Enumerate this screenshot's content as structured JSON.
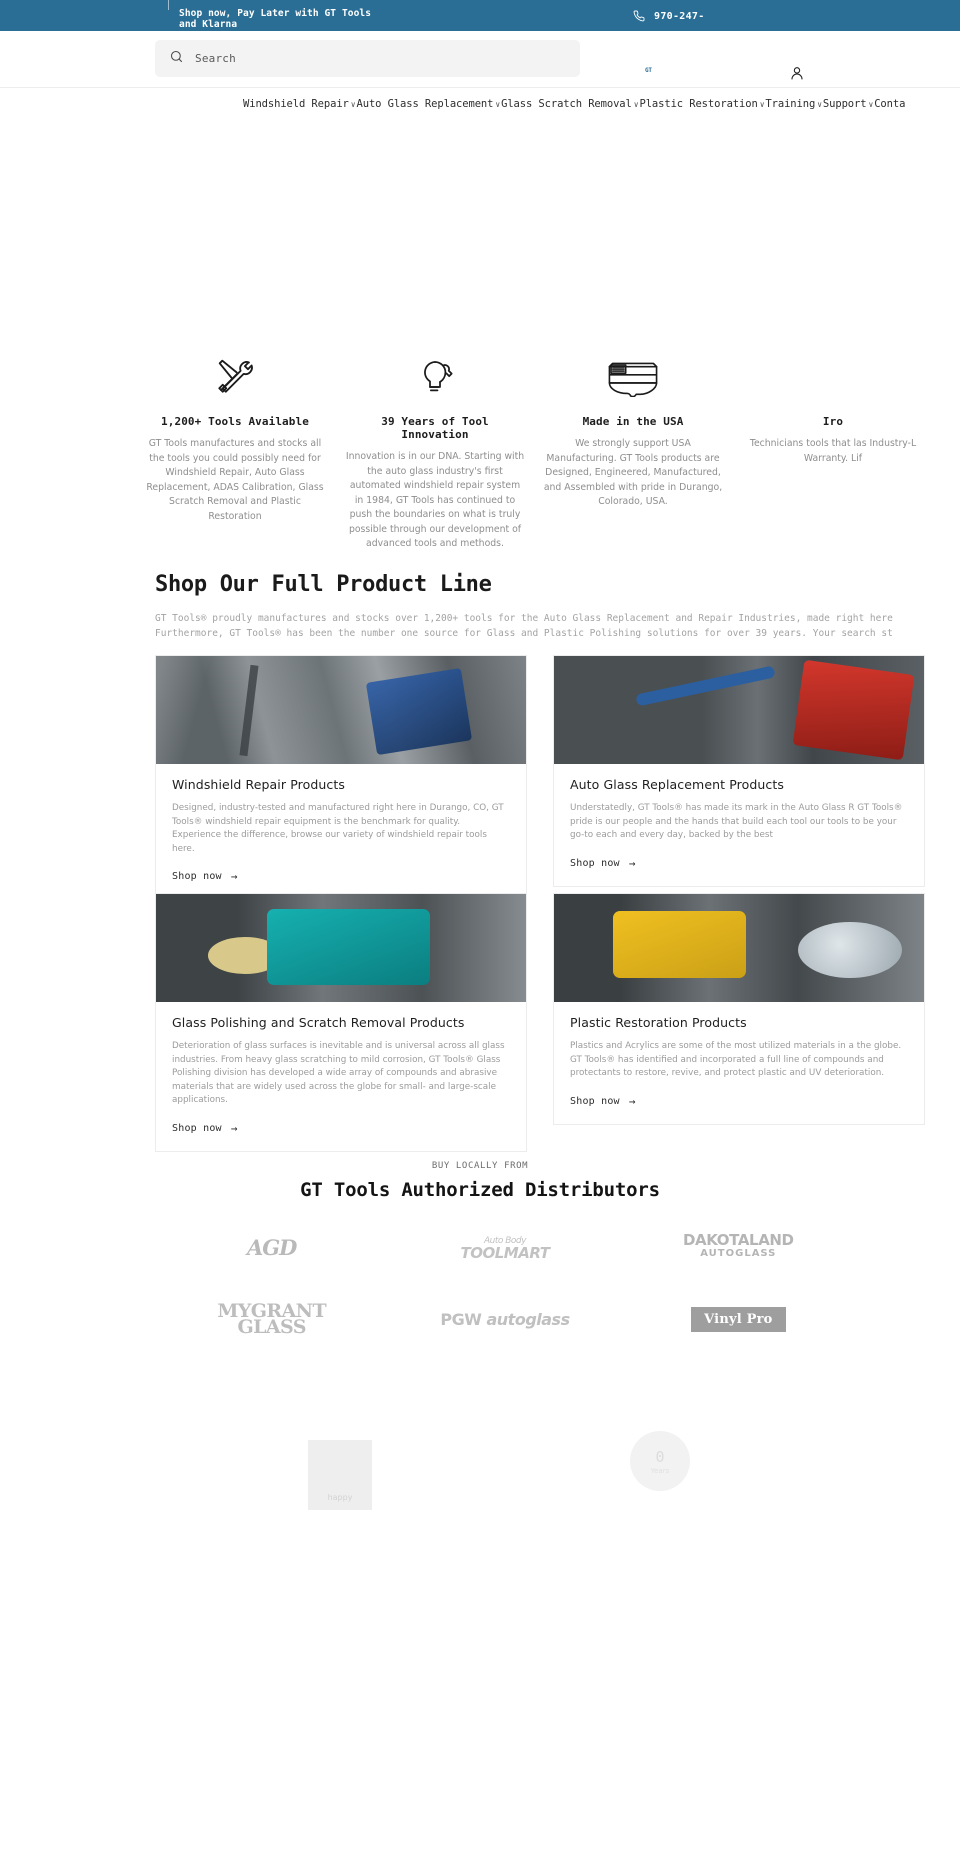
{
  "announcement": {
    "message": "Shop now, Pay Later with GT Tools and Klarna",
    "phone": "970-247-",
    "phone_icon": "phone-icon",
    "background": "#2a6e95"
  },
  "header": {
    "search": {
      "placeholder": "Search",
      "value": "",
      "icon": "search-icon"
    },
    "brand_mark": "GT",
    "account_icon": "account-icon"
  },
  "nav": {
    "items": [
      {
        "label": "Windshield Repair",
        "caret": "∨"
      },
      {
        "label": "Auto Glass Replacement",
        "caret": "∨"
      },
      {
        "label": "Glass Scratch Removal",
        "caret": "∨"
      },
      {
        "label": "Plastic Restoration",
        "caret": "∨"
      },
      {
        "label": "Training",
        "caret": "∨"
      },
      {
        "label": "Support",
        "caret": "∨"
      },
      {
        "label": "Conta",
        "caret": ""
      }
    ]
  },
  "features": [
    {
      "icon": "tools-icon",
      "title": "1,200+ Tools Available",
      "body": "GT Tools manufactures and stocks all the tools you could possibly need for Windshield Repair, Auto Glass Replacement, ADAS Calibration, Glass Scratch Removal and Plastic Restoration"
    },
    {
      "icon": "lightbulb-wrench-icon",
      "title": "39 Years of Tool Innovation",
      "body": "Innovation is in our DNA. Starting with the auto glass industry's first automated windshield repair system in 1984, GT Tools has continued to push the boundaries on what is truly possible through our development of advanced tools and methods."
    },
    {
      "icon": "usa-map-flag-icon",
      "title": "Made in the USA",
      "body": "We strongly support USA Manufacturing. GT Tools products are Designed, Engineered, Manufactured, and Assembled with pride in Durango, Colorado, USA."
    },
    {
      "icon": "warranty-icon",
      "title": "Iro",
      "body": "Technicians tools that las Industry-L Warranty. Lif"
    }
  ],
  "shop": {
    "title": "Shop Our Full Product Line",
    "subtitle_line1": "GT Tools® proudly manufactures and stocks over 1,200+ tools for the Auto Glass Replacement and Repair Industries, made right here",
    "subtitle_line2": "Furthermore, GT Tools® has been the number one source for Glass and Plastic Polishing solutions for over 39 years. Your search st",
    "cards": [
      {
        "image": "windshield-repair-photo",
        "title": "Windshield Repair Products",
        "description": "Designed, industry-tested and manufactured right here in Durango, CO, GT Tools® windshield repair equipment is the benchmark for quality. Experience the difference, browse our variety of windshield repair tools here.",
        "cta": "Shop now",
        "cta_arrow": "→"
      },
      {
        "image": "auto-glass-replacement-photo",
        "title": "Auto Glass Replacement Products",
        "description": "Understatedly, GT Tools® has made its mark in the Auto Glass R GT Tools® pride is our people and the hands that build each tool our tools to be your go-to each and every day, backed by the best",
        "cta": "Shop now",
        "cta_arrow": "→"
      },
      {
        "image": "glass-polishing-photo",
        "title": "Glass Polishing and Scratch Removal Products",
        "description": "Deterioration of glass surfaces is inevitable and is universal across all glass industries. From heavy glass scratching to mild corrosion, GT Tools® Glass Polishing division has developed a wide array of compounds and abrasive materials that are widely used across the globe for small- and large-scale applications.",
        "cta": "Shop now",
        "cta_arrow": "→"
      },
      {
        "image": "plastic-restoration-photo",
        "title": "Plastic Restoration Products",
        "description": "Plastics and Acrylics are some of the most utilized materials in a the globe. GT Tools® has identified and incorporated a full line of compounds and protectants to restore, revive, and protect plastic and UV deterioration.",
        "cta": "Shop now",
        "cta_arrow": "→"
      }
    ]
  },
  "distributors": {
    "eyebrow": "BUY LOCALLY FROM",
    "title": "GT Tools Authorized Distributors",
    "logos": [
      {
        "name": "agd-logo",
        "text": "AGD"
      },
      {
        "name": "auto-body-toolmart-logo",
        "text": "TOOLMART",
        "sub": "Auto Body"
      },
      {
        "name": "dakotaland-autoglass-logo",
        "text": "DAKOTALAND",
        "sub": "AUTOGLASS"
      },
      {
        "name": "mygrant-glass-logo",
        "text": "MYGRANT",
        "sub": "GLASS"
      },
      {
        "name": "pgw-autoglass-logo",
        "text": "PGW",
        "sub": "autoglass"
      },
      {
        "name": "vinyl-pro-logo",
        "text": "Vinyl Pro"
      }
    ]
  },
  "footer_fragments": {
    "box_label": "happy",
    "circle_number": "0",
    "circle_label": "Years"
  }
}
